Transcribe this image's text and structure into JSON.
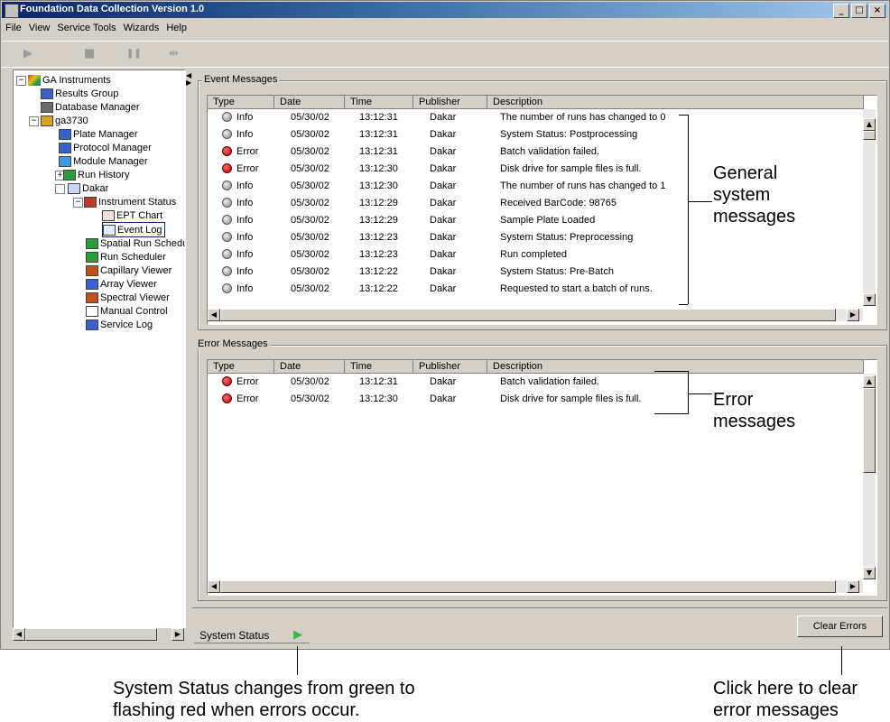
{
  "window": {
    "title": "Foundation Data Collection Version 1.0",
    "controls": [
      "_",
      "□",
      "×"
    ]
  },
  "menu": [
    "File",
    "View",
    "Service Tools",
    "Wizards",
    "Help"
  ],
  "toolbar": {
    "buttons": [
      {
        "name": "play-icon",
        "glyph": "▶"
      },
      {
        "name": "stop-icon",
        "glyph": "■"
      },
      {
        "name": "pause-icon",
        "glyph": "❚❚"
      },
      {
        "name": "skip-icon",
        "glyph": "⇹"
      }
    ]
  },
  "tree": {
    "items": [
      {
        "label": "GA Instruments",
        "color": "#2a9d3a"
      },
      {
        "label": "Results Group",
        "color": "#3b62c9"
      },
      {
        "label": "Database Manager",
        "color": "#6a6a6a"
      },
      {
        "label": "ga3730",
        "color": "#d9a520"
      },
      {
        "label": "Plate Manager",
        "color": "#3b62c9"
      },
      {
        "label": "Protocol Manager",
        "color": "#3b62c9"
      },
      {
        "label": "Module Manager",
        "color": "#3b9de0"
      },
      {
        "label": "Run History",
        "color": "#2a9d3a"
      },
      {
        "label": "Dakar",
        "color": "#3b62c9"
      },
      {
        "label": "Instrument Status",
        "color": "#c0392b"
      },
      {
        "label": "EPT Chart",
        "color": "#c0392b"
      },
      {
        "label": "Event Log",
        "color": "#3b62c9"
      },
      {
        "label": "Spatial Run Scheduler",
        "color": "#2a9d3a"
      },
      {
        "label": "Run Scheduler",
        "color": "#2a9d3a"
      },
      {
        "label": "Capillary Viewer",
        "color": "#c05020"
      },
      {
        "label": "Array Viewer",
        "color": "#3b62c9"
      },
      {
        "label": "Spectral Viewer",
        "color": "#c05020"
      },
      {
        "label": "Manual Control",
        "color": "#ffffff"
      },
      {
        "label": "Service Log",
        "color": "#3b62c9"
      }
    ]
  },
  "event_messages": {
    "title": "Event Messages",
    "columns": [
      "Type",
      "Date",
      "Time",
      "Publisher",
      "Description"
    ],
    "rows": [
      {
        "type": "Info",
        "date": "05/30/02",
        "time": "13:12:31",
        "publisher": "Dakar",
        "description": "The number of runs has changed to 0"
      },
      {
        "type": "Info",
        "date": "05/30/02",
        "time": "13:12:31",
        "publisher": "Dakar",
        "description": "System Status: Postprocessing"
      },
      {
        "type": "Error",
        "date": "05/30/02",
        "time": "13:12:31",
        "publisher": "Dakar",
        "description": "Batch validation failed."
      },
      {
        "type": "Error",
        "date": "05/30/02",
        "time": "13:12:30",
        "publisher": "Dakar",
        "description": "Disk drive for sample files is full."
      },
      {
        "type": "Info",
        "date": "05/30/02",
        "time": "13:12:30",
        "publisher": "Dakar",
        "description": "The number of runs has changed to 1"
      },
      {
        "type": "Info",
        "date": "05/30/02",
        "time": "13:12:29",
        "publisher": "Dakar",
        "description": "Received BarCode: 98765"
      },
      {
        "type": "Info",
        "date": "05/30/02",
        "time": "13:12:29",
        "publisher": "Dakar",
        "description": "Sample Plate Loaded"
      },
      {
        "type": "Info",
        "date": "05/30/02",
        "time": "13:12:23",
        "publisher": "Dakar",
        "description": "System Status: Preprocessing"
      },
      {
        "type": "Info",
        "date": "05/30/02",
        "time": "13:12:23",
        "publisher": "Dakar",
        "description": "Run completed"
      },
      {
        "type": "Info",
        "date": "05/30/02",
        "time": "13:12:22",
        "publisher": "Dakar",
        "description": "System Status: Pre-Batch"
      },
      {
        "type": "Info",
        "date": "05/30/02",
        "time": "13:12:22",
        "publisher": "Dakar",
        "description": "Requested to start a batch of runs."
      }
    ]
  },
  "error_messages": {
    "title": "Error Messages",
    "columns": [
      "Type",
      "Date",
      "Time",
      "Publisher",
      "Description"
    ],
    "rows": [
      {
        "type": "Error",
        "date": "05/30/02",
        "time": "13:12:31",
        "publisher": "Dakar",
        "description": "Batch validation failed."
      },
      {
        "type": "Error",
        "date": "05/30/02",
        "time": "13:12:30",
        "publisher": "Dakar",
        "description": "Disk drive for sample files is full."
      }
    ]
  },
  "status": {
    "label": "System Status",
    "indicator_color": "#3cb43c"
  },
  "clear_errors_label": "Clear Errors",
  "annotations": {
    "general": "General system messages",
    "error": "Error messages",
    "status": "System Status changes from green to flashing red when errors occur.",
    "clear": "Click here to clear error messages"
  }
}
